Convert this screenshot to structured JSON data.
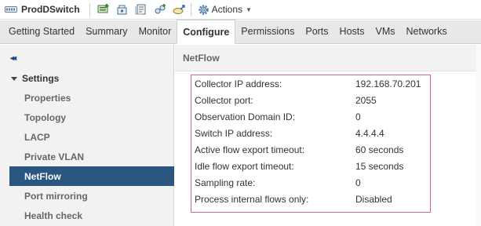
{
  "toolbar": {
    "object_title": "ProdDSwitch",
    "object_icon": "distributed-switch-icon",
    "icons": [
      "add-host-icon",
      "migrate-network-icon",
      "manage-port-groups-icon",
      "new-port-group-icon",
      "export-config-icon"
    ],
    "actions_label": "Actions"
  },
  "tabs": [
    {
      "label": "Getting Started"
    },
    {
      "label": "Summary"
    },
    {
      "label": "Monitor"
    },
    {
      "label": "Configure",
      "active": true
    },
    {
      "label": "Permissions"
    },
    {
      "label": "Ports"
    },
    {
      "label": "Hosts"
    },
    {
      "label": "VMs"
    },
    {
      "label": "Networks"
    }
  ],
  "leftnav": {
    "collapse_glyph": "◂◂",
    "section_label": "Settings",
    "items": [
      {
        "label": "Properties"
      },
      {
        "label": "Topology"
      },
      {
        "label": "LACP"
      },
      {
        "label": "Private VLAN"
      },
      {
        "label": "NetFlow",
        "selected": true
      },
      {
        "label": "Port mirroring"
      },
      {
        "label": "Health check"
      }
    ]
  },
  "content": {
    "title": "NetFlow",
    "properties": [
      {
        "label": "Collector IP address:",
        "value": "192.168.70.201"
      },
      {
        "label": "Collector port:",
        "value": "2055"
      },
      {
        "label": "Observation Domain ID:",
        "value": "0"
      },
      {
        "label": "Switch IP address:",
        "value": "4.4.4.4"
      },
      {
        "label": "Active flow export timeout:",
        "value": "60 seconds"
      },
      {
        "label": "Idle flow export timeout:",
        "value": "15 seconds"
      },
      {
        "label": "Sampling rate:",
        "value": "0"
      },
      {
        "label": "Process internal flows only:",
        "value": "Disabled"
      }
    ]
  },
  "colors": {
    "selected_nav_bg": "#2b567f",
    "highlight_border": "#d9668f"
  }
}
